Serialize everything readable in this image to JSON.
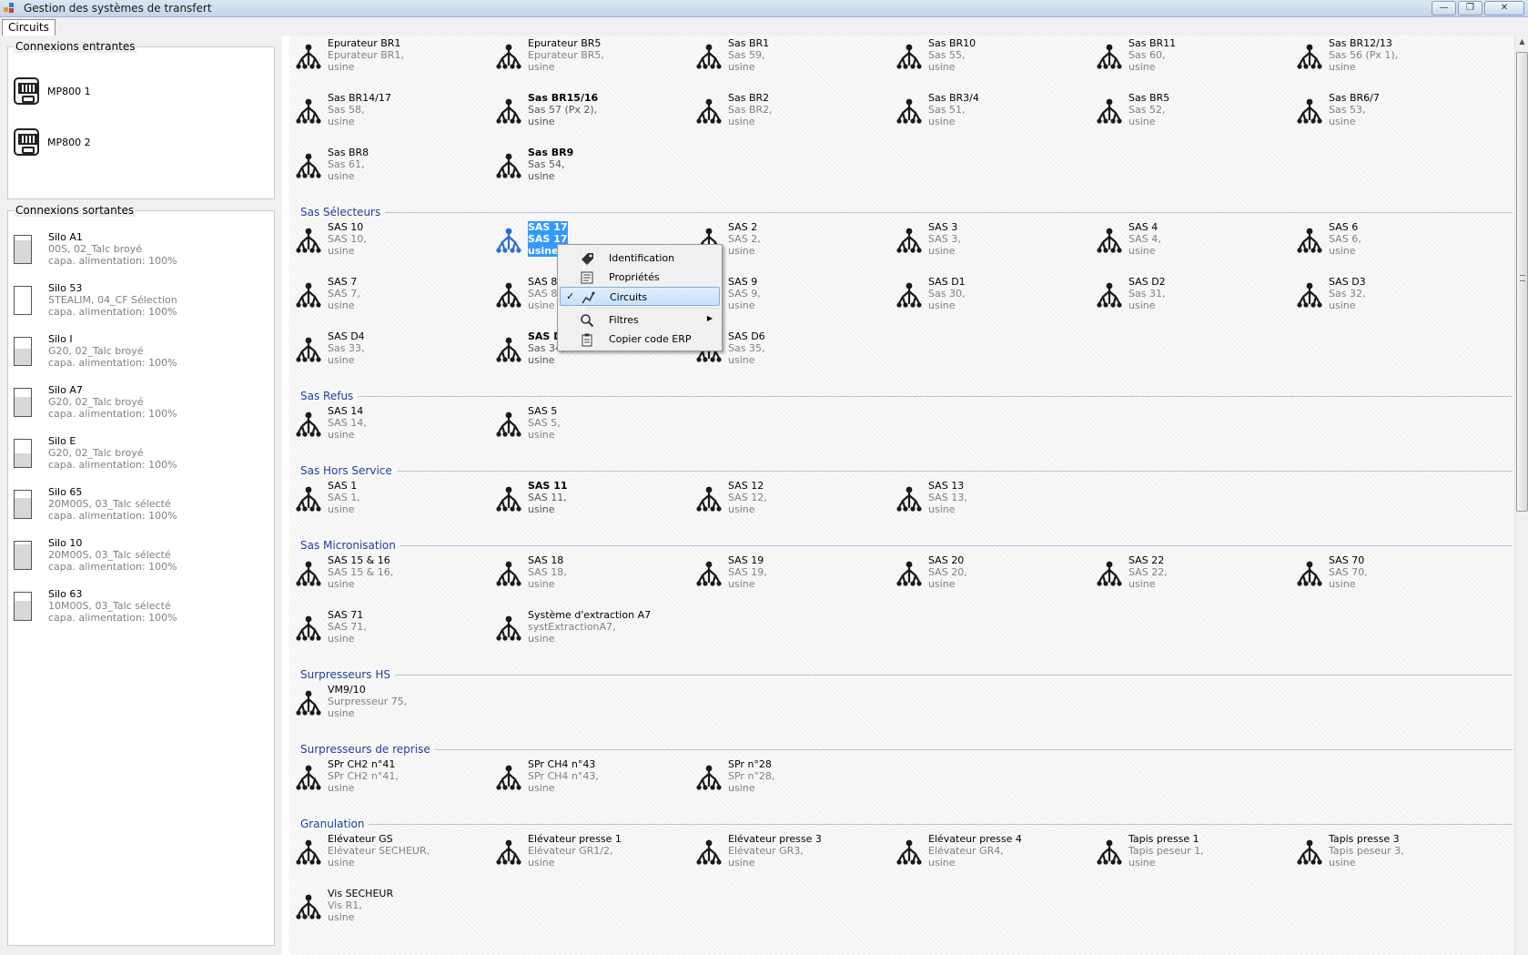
{
  "window": {
    "title": "Gestion des systèmes de transfert"
  },
  "tabs": [
    {
      "label": "Circuits"
    }
  ],
  "left": {
    "incoming_title": "Connexions entrantes",
    "incoming": [
      {
        "name": "MP800 1"
      },
      {
        "name": "MP800 2"
      }
    ],
    "outgoing_title": "Connexions sortantes",
    "outgoing": [
      {
        "name": "Silo A1",
        "line2": "00S, 02_Talc broyé",
        "line3": "capa. alimentation: 100%",
        "level": 0.85
      },
      {
        "name": "Silo 53",
        "line2": "STEALIM, 04_CF Sélection",
        "line3": "capa. alimentation: 100%",
        "level": 0.0
      },
      {
        "name": "Silo I",
        "line2": "G20, 02_Talc broyé",
        "line3": "capa. alimentation: 100%",
        "level": 0.6
      },
      {
        "name": "Silo A7",
        "line2": "G20, 02_Talc broyé",
        "line3": "capa. alimentation: 100%",
        "level": 0.7
      },
      {
        "name": "Silo E",
        "line2": "G20, 02_Talc broyé",
        "line3": "capa. alimentation: 100%",
        "level": 0.5
      },
      {
        "name": "Silo 65",
        "line2": "20M00S, 03_Talc sélecté",
        "line3": "capa. alimentation: 100%",
        "level": 0.75
      },
      {
        "name": "Silo 10",
        "line2": "20M00S, 03_Talc sélecté",
        "line3": "capa. alimentation: 100%",
        "level": 0.9
      },
      {
        "name": "Silo 63",
        "line2": "10M00S, 03_Talc sélecté",
        "line3": "capa. alimentation: 100%",
        "level": 0.7
      }
    ]
  },
  "rows": [
    {
      "items": [
        {
          "name": "Epurateur BR1",
          "sub": "Epurateur BR1,",
          "plant": "usine"
        },
        {
          "name": "Epurateur BR5",
          "sub": "Epurateur BR5,",
          "plant": "usine"
        },
        {
          "name": "Sas BR1",
          "sub": "Sas 59,",
          "plant": "usine"
        },
        {
          "name": "Sas BR10",
          "sub": "Sas 55,",
          "plant": "usine"
        },
        {
          "name": "Sas BR11",
          "sub": "Sas 60,",
          "plant": "usine"
        },
        {
          "name": "Sas BR12/13",
          "sub": "Sas 56 (Px 1),",
          "plant": "usine"
        }
      ]
    },
    {
      "items": [
        {
          "name": "Sas BR14/17",
          "sub": "Sas 58,",
          "plant": "usine"
        },
        {
          "name": "Sas BR15/16",
          "sub": "Sas 57 (Px 2),",
          "plant": "usine",
          "bold": true
        },
        {
          "name": "Sas BR2",
          "sub": "Sas BR2,",
          "plant": "usine"
        },
        {
          "name": "Sas BR3/4",
          "sub": "Sas 51,",
          "plant": "usine"
        },
        {
          "name": "Sas BR5",
          "sub": "Sas 52,",
          "plant": "usine"
        },
        {
          "name": "Sas BR6/7",
          "sub": "Sas 53,",
          "plant": "usine"
        }
      ]
    },
    {
      "items": [
        {
          "name": "Sas BR8",
          "sub": "Sas 61,",
          "plant": "usine"
        },
        {
          "name": "Sas BR9",
          "sub": "Sas 54,",
          "plant": "usine",
          "bold": true
        }
      ]
    },
    {
      "section": "Sas Sélecteurs"
    },
    {
      "items": [
        {
          "name": "SAS 10",
          "sub": "SAS 10,",
          "plant": "usine"
        },
        {
          "name": "SAS 17",
          "sub": "SAS 17",
          "plant": "usine",
          "selected": true
        },
        {
          "name": "SAS 2",
          "sub": "SAS 2,",
          "plant": "usine"
        },
        {
          "name": "SAS 3",
          "sub": "SAS 3,",
          "plant": "usine"
        },
        {
          "name": "SAS 4",
          "sub": "SAS 4,",
          "plant": "usine"
        },
        {
          "name": "SAS 6",
          "sub": "SAS 6,",
          "plant": "usine"
        }
      ]
    },
    {
      "items": [
        {
          "name": "SAS 7",
          "sub": "SAS 7,",
          "plant": "usine"
        },
        {
          "name": "SAS 8",
          "sub": "SAS 8,",
          "plant": "usine"
        },
        {
          "name": "SAS 9",
          "sub": "SAS 9,",
          "plant": "usine"
        },
        {
          "name": "SAS D1",
          "sub": "Sas 30,",
          "plant": "usine"
        },
        {
          "name": "SAS D2",
          "sub": "Sas 31,",
          "plant": "usine"
        },
        {
          "name": "SAS D3",
          "sub": "Sas 32,",
          "plant": "usine"
        }
      ]
    },
    {
      "items": [
        {
          "name": "SAS D4",
          "sub": "Sas 33,",
          "plant": "usine"
        },
        {
          "name": "SAS D5",
          "sub": "Sas 34,",
          "plant": "usine",
          "bold": true
        },
        {
          "name": "SAS D6",
          "sub": "Sas 35,",
          "plant": "usine"
        }
      ]
    },
    {
      "section": "Sas Refus"
    },
    {
      "items": [
        {
          "name": "SAS 14",
          "sub": "SAS 14,",
          "plant": "usine"
        },
        {
          "name": "SAS 5",
          "sub": "SAS 5,",
          "plant": "usine"
        }
      ]
    },
    {
      "section": "Sas Hors Service"
    },
    {
      "items": [
        {
          "name": "SAS 1",
          "sub": "SAS 1,",
          "plant": "usine"
        },
        {
          "name": "SAS 11",
          "sub": "SAS 11,",
          "plant": "usine",
          "bold": true
        },
        {
          "name": "SAS 12",
          "sub": "SAS 12,",
          "plant": "usine"
        },
        {
          "name": "SAS 13",
          "sub": "SAS 13,",
          "plant": "usine"
        }
      ]
    },
    {
      "section": "Sas Micronisation"
    },
    {
      "items": [
        {
          "name": "SAS 15 & 16",
          "sub": "SAS 15 & 16,",
          "plant": "usine"
        },
        {
          "name": "SAS 18",
          "sub": "SAS 18,",
          "plant": "usine"
        },
        {
          "name": "SAS 19",
          "sub": "SAS 19,",
          "plant": "usine"
        },
        {
          "name": "SAS 20",
          "sub": "SAS 20,",
          "plant": "usine"
        },
        {
          "name": "SAS 22",
          "sub": "SAS 22,",
          "plant": "usine"
        },
        {
          "name": "SAS 70",
          "sub": "SAS 70,",
          "plant": "usine"
        }
      ]
    },
    {
      "items": [
        {
          "name": "SAS 71",
          "sub": "SAS 71,",
          "plant": "usine"
        },
        {
          "name": "Système d'extraction A7",
          "sub": "systExtractionA7,",
          "plant": "usine"
        }
      ]
    },
    {
      "section": "Surpresseurs HS"
    },
    {
      "items": [
        {
          "name": "VM9/10",
          "sub": "Surpresseur 75,",
          "plant": "usine"
        }
      ]
    },
    {
      "section": "Surpresseurs de reprise"
    },
    {
      "items": [
        {
          "name": "SPr CH2 n°41",
          "sub": "SPr CH2 n°41,",
          "plant": "usine"
        },
        {
          "name": "SPr CH4 n°43",
          "sub": "SPr CH4 n°43,",
          "plant": "usine"
        },
        {
          "name": "SPr n°28",
          "sub": "SPr n°28,",
          "plant": "usine"
        }
      ]
    },
    {
      "section": "Granulation"
    },
    {
      "items": [
        {
          "name": "Elévateur GS",
          "sub": "Elévateur SECHEUR,",
          "plant": "usine"
        },
        {
          "name": "Elévateur presse 1",
          "sub": "Elévateur GR1/2,",
          "plant": "usine"
        },
        {
          "name": "Elévateur presse 3",
          "sub": "Elévateur GR3,",
          "plant": "usine"
        },
        {
          "name": "Elévateur presse 4",
          "sub": "Elévateur GR4,",
          "plant": "usine"
        },
        {
          "name": "Tapis presse 1",
          "sub": "Tapis peseur 1,",
          "plant": "usine"
        },
        {
          "name": "Tapis presse 3",
          "sub": "Tapis peseur 3,",
          "plant": "usine"
        }
      ]
    },
    {
      "items": [
        {
          "name": "Vis SECHEUR",
          "sub": "Vis R1,",
          "plant": "usine"
        }
      ]
    }
  ],
  "context_menu": {
    "items": [
      {
        "label": "Identification",
        "icon": "tag-icon"
      },
      {
        "label": "Propriétés",
        "icon": "properties-icon"
      },
      {
        "label": "Circuits",
        "icon": "circuits-icon",
        "checked": true,
        "highlighted": true
      },
      {
        "label": "Filtres",
        "icon": "magnifier-icon",
        "submenu": true
      },
      {
        "label": "Copier code ERP",
        "icon": "clipboard-icon"
      }
    ]
  }
}
